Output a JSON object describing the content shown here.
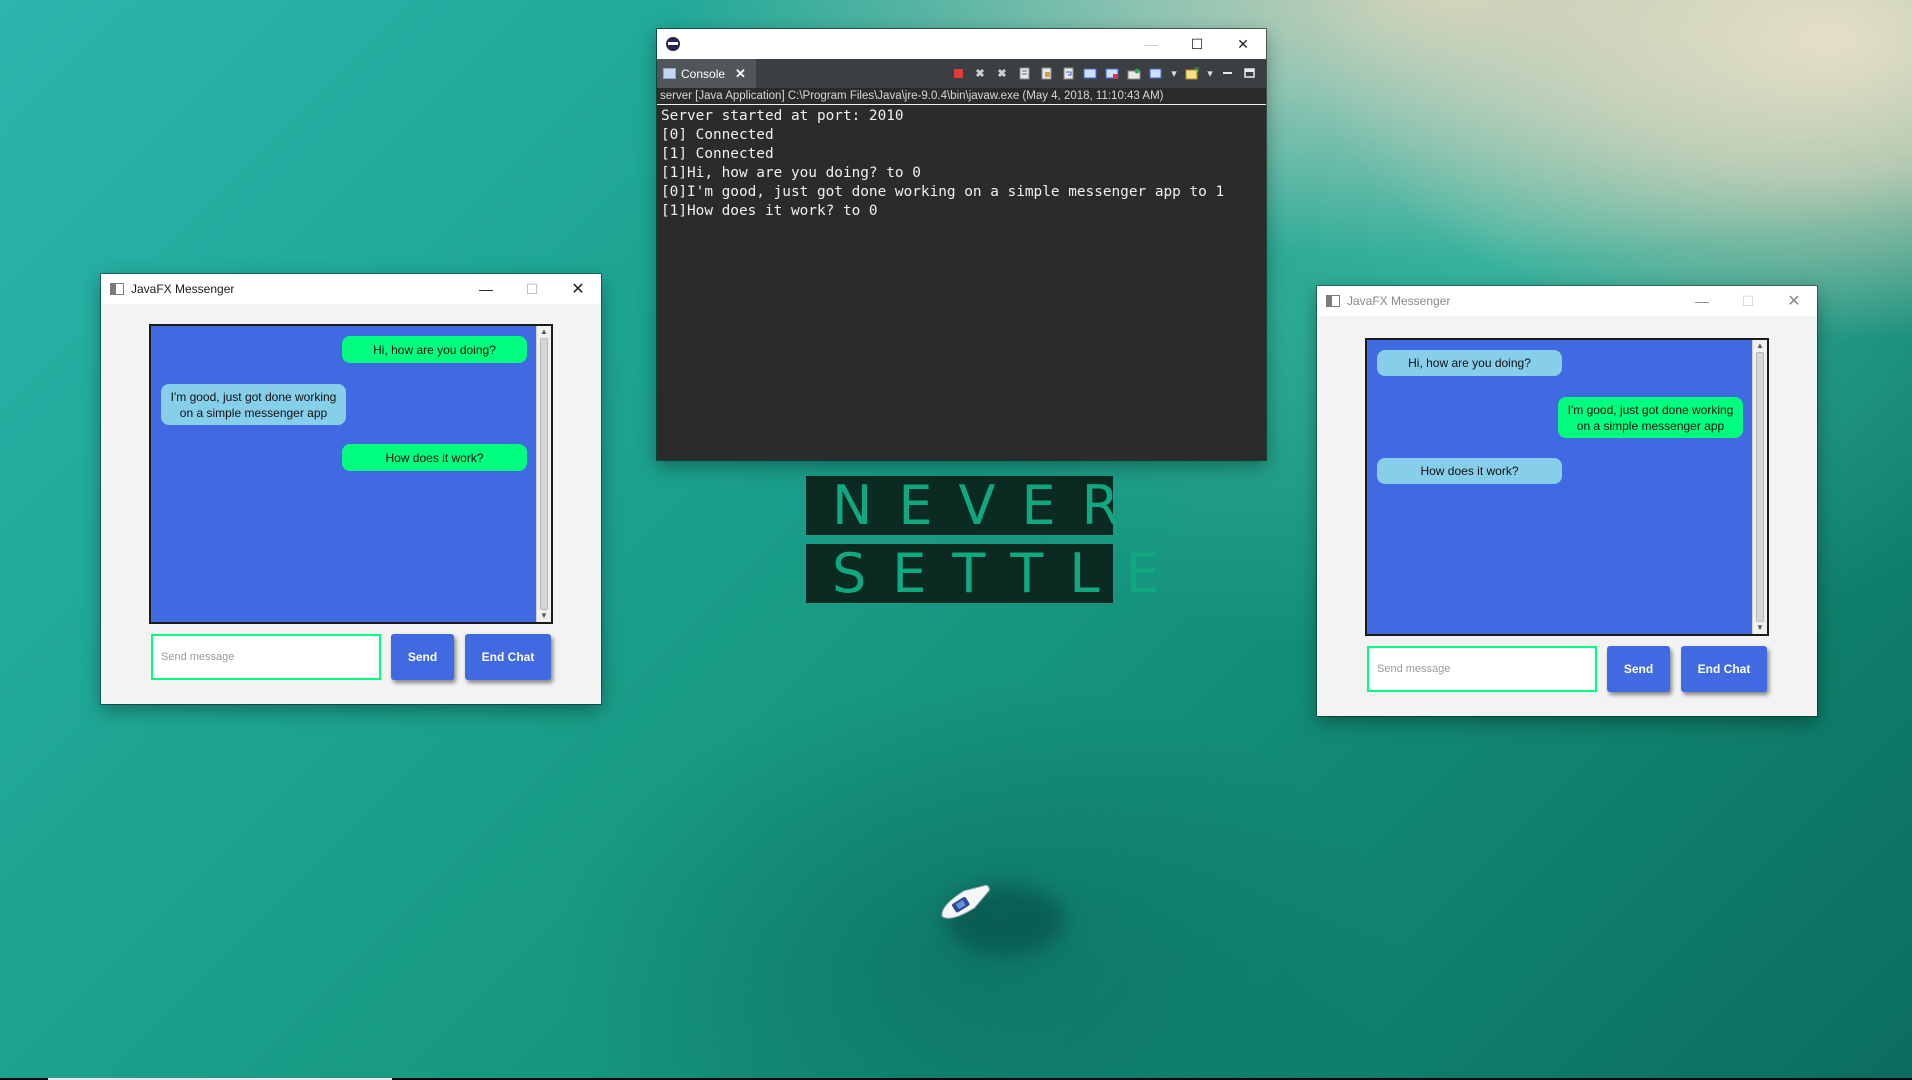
{
  "desktop": {
    "wallpaper_text": [
      "NEVER",
      "SETTLE"
    ]
  },
  "console_window": {
    "tab_label": "Console",
    "path": "server [Java Application] C:\\Program Files\\Java\\jre-9.0.4\\bin\\javaw.exe (May 4, 2018, 11:10:43 AM)",
    "lines": [
      "Server started at port: 2010",
      "[0] Connected",
      "[1] Connected",
      "[1]Hi, how are you doing? to 0",
      "[0]I'm good, just got done working on a simple messenger app to 1",
      "[1]How does it work? to 0"
    ]
  },
  "messenger_left": {
    "title": "JavaFX Messenger",
    "messages": [
      {
        "text": "Hi, how are you doing?",
        "side": "right",
        "color": "#00ff7f"
      },
      {
        "text": "I'm good, just got done working\non a simple messenger app",
        "side": "left",
        "color": "#87ceeb"
      },
      {
        "text": "How does it work?",
        "side": "right",
        "color": "#00ff7f"
      }
    ],
    "input_placeholder": "Send message",
    "send_label": "Send",
    "end_label": "End Chat"
  },
  "messenger_right": {
    "title": "JavaFX Messenger",
    "messages": [
      {
        "text": "Hi, how are you doing?",
        "side": "left",
        "color": "#87ceeb"
      },
      {
        "text": "I'm good, just got done working\non a simple messenger app",
        "side": "right",
        "color": "#00ff7f"
      },
      {
        "text": "How does it work?",
        "side": "left",
        "color": "#87ceeb"
      }
    ],
    "input_placeholder": "Send message",
    "send_label": "Send",
    "end_label": "End Chat"
  },
  "colors": {
    "chat_background": "#4169e1",
    "own_bubble": "#00ff7f",
    "other_bubble": "#87ceeb",
    "console_background": "#2b2b2b"
  }
}
